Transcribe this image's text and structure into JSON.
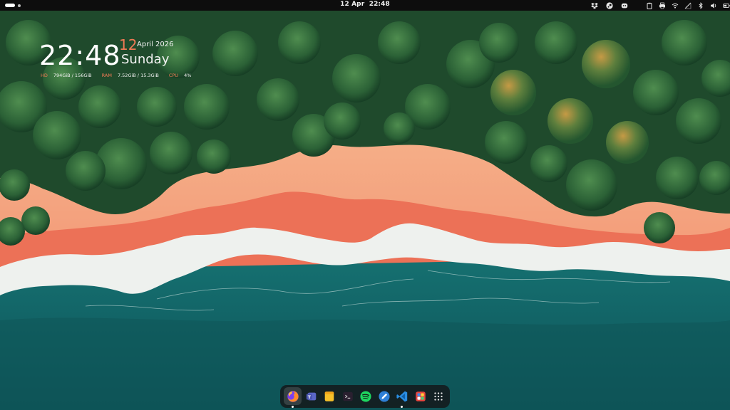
{
  "topbar": {
    "date": "12 Apr",
    "time": "22:48",
    "activities_indicator": [
      "active-workspace",
      "workspace"
    ],
    "tray_left_icons": [
      "dropbox-icon",
      "steam-icon",
      "discord-icon"
    ],
    "tray_right_icons": [
      "clipboard-icon",
      "printer-icon",
      "network-icon",
      "no-signal-icon",
      "bluetooth-icon",
      "volume-icon",
      "battery-icon"
    ]
  },
  "conky": {
    "time": "22:48",
    "day": "12",
    "month_year": "April 2026",
    "weekday": "Sunday",
    "hd_label": "HD",
    "hd_value": "794GiB / 156GiB",
    "ram_label": "RAM",
    "ram_value": "7.52GiB / 15.3GiB",
    "cpu_label": "CPU",
    "cpu_value": "4%"
  },
  "dock": {
    "apps": [
      {
        "name": "firefox",
        "icon": "firefox-icon",
        "running": true,
        "focused": true
      },
      {
        "name": "teams",
        "icon": "teams-icon",
        "running": false
      },
      {
        "name": "notes",
        "icon": "notes-icon",
        "running": false
      },
      {
        "name": "terminal",
        "icon": "terminal-icon",
        "running": false
      },
      {
        "name": "spotify",
        "icon": "spotify-icon",
        "running": false
      },
      {
        "name": "text-editor",
        "icon": "pencil-icon",
        "running": false
      },
      {
        "name": "vscode",
        "icon": "vscode-icon",
        "running": true
      },
      {
        "name": "software",
        "icon": "software-store-icon",
        "running": false
      },
      {
        "name": "app-grid",
        "icon": "app-grid-icon",
        "running": false
      }
    ]
  },
  "colors": {
    "accent": "#f07a55",
    "topbar": "#0d0d0d",
    "forest": "#2f6a3a",
    "sand": "#f2a07c",
    "sea": "#1f8f8a"
  }
}
